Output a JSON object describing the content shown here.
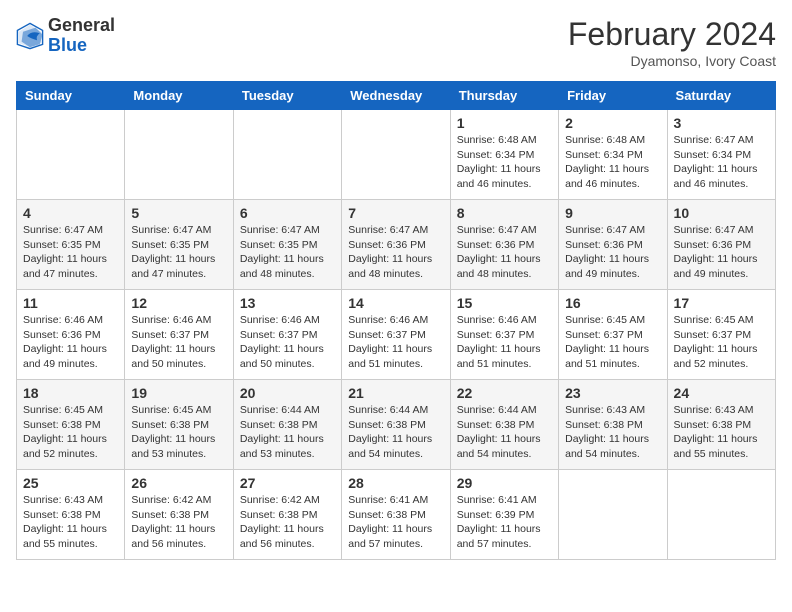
{
  "header": {
    "logo_general": "General",
    "logo_blue": "Blue",
    "month_year": "February 2024",
    "location": "Dyamonso, Ivory Coast"
  },
  "days_of_week": [
    "Sunday",
    "Monday",
    "Tuesday",
    "Wednesday",
    "Thursday",
    "Friday",
    "Saturday"
  ],
  "weeks": [
    [
      {
        "day": "",
        "info": ""
      },
      {
        "day": "",
        "info": ""
      },
      {
        "day": "",
        "info": ""
      },
      {
        "day": "",
        "info": ""
      },
      {
        "day": "1",
        "info": "Sunrise: 6:48 AM\nSunset: 6:34 PM\nDaylight: 11 hours and 46 minutes."
      },
      {
        "day": "2",
        "info": "Sunrise: 6:48 AM\nSunset: 6:34 PM\nDaylight: 11 hours and 46 minutes."
      },
      {
        "day": "3",
        "info": "Sunrise: 6:47 AM\nSunset: 6:34 PM\nDaylight: 11 hours and 46 minutes."
      }
    ],
    [
      {
        "day": "4",
        "info": "Sunrise: 6:47 AM\nSunset: 6:35 PM\nDaylight: 11 hours and 47 minutes."
      },
      {
        "day": "5",
        "info": "Sunrise: 6:47 AM\nSunset: 6:35 PM\nDaylight: 11 hours and 47 minutes."
      },
      {
        "day": "6",
        "info": "Sunrise: 6:47 AM\nSunset: 6:35 PM\nDaylight: 11 hours and 48 minutes."
      },
      {
        "day": "7",
        "info": "Sunrise: 6:47 AM\nSunset: 6:36 PM\nDaylight: 11 hours and 48 minutes."
      },
      {
        "day": "8",
        "info": "Sunrise: 6:47 AM\nSunset: 6:36 PM\nDaylight: 11 hours and 48 minutes."
      },
      {
        "day": "9",
        "info": "Sunrise: 6:47 AM\nSunset: 6:36 PM\nDaylight: 11 hours and 49 minutes."
      },
      {
        "day": "10",
        "info": "Sunrise: 6:47 AM\nSunset: 6:36 PM\nDaylight: 11 hours and 49 minutes."
      }
    ],
    [
      {
        "day": "11",
        "info": "Sunrise: 6:46 AM\nSunset: 6:36 PM\nDaylight: 11 hours and 49 minutes."
      },
      {
        "day": "12",
        "info": "Sunrise: 6:46 AM\nSunset: 6:37 PM\nDaylight: 11 hours and 50 minutes."
      },
      {
        "day": "13",
        "info": "Sunrise: 6:46 AM\nSunset: 6:37 PM\nDaylight: 11 hours and 50 minutes."
      },
      {
        "day": "14",
        "info": "Sunrise: 6:46 AM\nSunset: 6:37 PM\nDaylight: 11 hours and 51 minutes."
      },
      {
        "day": "15",
        "info": "Sunrise: 6:46 AM\nSunset: 6:37 PM\nDaylight: 11 hours and 51 minutes."
      },
      {
        "day": "16",
        "info": "Sunrise: 6:45 AM\nSunset: 6:37 PM\nDaylight: 11 hours and 51 minutes."
      },
      {
        "day": "17",
        "info": "Sunrise: 6:45 AM\nSunset: 6:37 PM\nDaylight: 11 hours and 52 minutes."
      }
    ],
    [
      {
        "day": "18",
        "info": "Sunrise: 6:45 AM\nSunset: 6:38 PM\nDaylight: 11 hours and 52 minutes."
      },
      {
        "day": "19",
        "info": "Sunrise: 6:45 AM\nSunset: 6:38 PM\nDaylight: 11 hours and 53 minutes."
      },
      {
        "day": "20",
        "info": "Sunrise: 6:44 AM\nSunset: 6:38 PM\nDaylight: 11 hours and 53 minutes."
      },
      {
        "day": "21",
        "info": "Sunrise: 6:44 AM\nSunset: 6:38 PM\nDaylight: 11 hours and 54 minutes."
      },
      {
        "day": "22",
        "info": "Sunrise: 6:44 AM\nSunset: 6:38 PM\nDaylight: 11 hours and 54 minutes."
      },
      {
        "day": "23",
        "info": "Sunrise: 6:43 AM\nSunset: 6:38 PM\nDaylight: 11 hours and 54 minutes."
      },
      {
        "day": "24",
        "info": "Sunrise: 6:43 AM\nSunset: 6:38 PM\nDaylight: 11 hours and 55 minutes."
      }
    ],
    [
      {
        "day": "25",
        "info": "Sunrise: 6:43 AM\nSunset: 6:38 PM\nDaylight: 11 hours and 55 minutes."
      },
      {
        "day": "26",
        "info": "Sunrise: 6:42 AM\nSunset: 6:38 PM\nDaylight: 11 hours and 56 minutes."
      },
      {
        "day": "27",
        "info": "Sunrise: 6:42 AM\nSunset: 6:38 PM\nDaylight: 11 hours and 56 minutes."
      },
      {
        "day": "28",
        "info": "Sunrise: 6:41 AM\nSunset: 6:38 PM\nDaylight: 11 hours and 57 minutes."
      },
      {
        "day": "29",
        "info": "Sunrise: 6:41 AM\nSunset: 6:39 PM\nDaylight: 11 hours and 57 minutes."
      },
      {
        "day": "",
        "info": ""
      },
      {
        "day": "",
        "info": ""
      }
    ]
  ]
}
